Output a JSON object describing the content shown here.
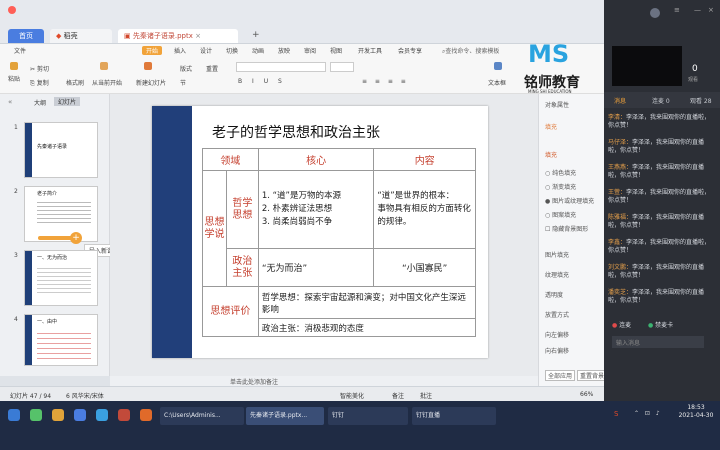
{
  "titlebar": {
    "tabs": [
      {
        "label": "首页"
      },
      {
        "label": "稻壳"
      },
      {
        "label": "先秦诸子语录.pptx"
      }
    ],
    "new_tab": "+"
  },
  "menu": {
    "file": "文件",
    "items": [
      "开始",
      "插入",
      "设计",
      "切换",
      "动画",
      "放映",
      "审阅",
      "视图",
      "开发工具",
      "会员专享"
    ],
    "search": "查找命令、搜索模板"
  },
  "ribbon": {
    "cut": "剪切",
    "copy": "复制",
    "format_painter": "格式刷",
    "from_start": "从当前开始",
    "new_slide": "新建幻灯片",
    "layout": "版式",
    "section": "节",
    "reset": "重置",
    "textbox": "文本框",
    "paste": "粘贴"
  },
  "leftpanel": {
    "tabs": [
      "大纲",
      "幻灯片"
    ],
    "thumbs": [
      {
        "num": "1",
        "title": "先秦诸子语录"
      },
      {
        "num": "2",
        "title": "老子简介"
      },
      {
        "num": "3",
        "title": "一、无为而治"
      },
      {
        "num": "4",
        "title": "一、由中"
      }
    ],
    "import_tip": "导入新课",
    "add": "+"
  },
  "slide": {
    "title": "老子的哲学思想和政治主张",
    "table": {
      "headers": [
        "领域",
        "核心",
        "内容"
      ],
      "row_group_label": "思想学说",
      "philosophy_label": "哲学思想",
      "philosophy_core": "1. “道”是万物的本源\n2. 朴素辨证法思想\n3. 尚柔尚弱尚不争",
      "philosophy_content": "“道”是世界的根本：\n事物具有相反的方面转化的规律。",
      "politics_label": "政治主张",
      "politics_core": "“无为而治”",
      "politics_content": "“小国寡民”",
      "eval_label": "思想评价",
      "eval_1": "哲学思想：探索宇宙起源和演变；对中国文化产生深远影响",
      "eval_2": "政治主张：消极悲观的态度"
    }
  },
  "notes": {
    "placeholder": "单击此处添加备注"
  },
  "status": {
    "slide_count": "幻灯片 47 / 94",
    "theme": "6 风华宋/宋体",
    "smart": "智能美化",
    "notes_btn": "备注",
    "comment_btn": "批注",
    "zoom": "66%"
  },
  "props": {
    "title": "对象属性",
    "fill_tab": "填充",
    "fill_section": "填充",
    "options": [
      "纯色填充",
      "渐变填充",
      "图片或纹理填充",
      "图案填充",
      "隐藏背景图形"
    ],
    "labels": [
      "图片填充",
      "纹理填充",
      "透明度",
      "放置方式",
      "向左偏移",
      "向右偏移"
    ],
    "apply_all": "全部应用",
    "reset_bg": "重置背景"
  },
  "watermark": {
    "logo": "MS",
    "cn": "铭师教育",
    "en": "MING SHI EDUCATION"
  },
  "live": {
    "count": "0",
    "count_label": "观看",
    "tabs": [
      "消息",
      "连麦 0",
      "观看 28"
    ],
    "messages": [
      {
        "name": "李清：",
        "msg": "李泽泽，我来围观你的直播啦，你点赞！"
      },
      {
        "name": "马仔泽：",
        "msg": "李泽泽，我来围观你的直播啦，你点赞！"
      },
      {
        "name": "王燕燕：",
        "msg": "李泽泽，我来围观你的直播啦，你点赞！"
      },
      {
        "name": "王萱：",
        "msg": "李泽泽，我来围观你的直播啦，你点赞！"
      },
      {
        "name": "陈雅福：",
        "msg": "李泽泽，我来围观你的直播啦，你点赞！"
      },
      {
        "name": "李鑫：",
        "msg": "李泽泽，我来围观你的直播啦，你点赞！"
      },
      {
        "name": "刘文鹏：",
        "msg": "李泽泽，我来围观你的直播啦，你点赞！"
      },
      {
        "name": "潘奕芝：",
        "msg": "李泽泽，我来围观你的直播啦，你点赞！"
      }
    ],
    "mic_label": "连麦",
    "mic2_label": "禁麦卡",
    "input_placeholder": "输入消息"
  },
  "taskbar": {
    "items": [
      {
        "label": "C:\\Users\\Adminis..."
      },
      {
        "label": "先秦诸子语录.pptx..."
      },
      {
        "label": "钉钉"
      },
      {
        "label": "钉钉直播"
      }
    ],
    "time": "18:53",
    "date": "2021-04-30"
  },
  "colors": {
    "accent": "#4a7de0",
    "slide_bar": "#213f7a",
    "table_red": "#c5402f",
    "taskbar": "#1f2b44",
    "live_bg": "#2c2f36"
  }
}
